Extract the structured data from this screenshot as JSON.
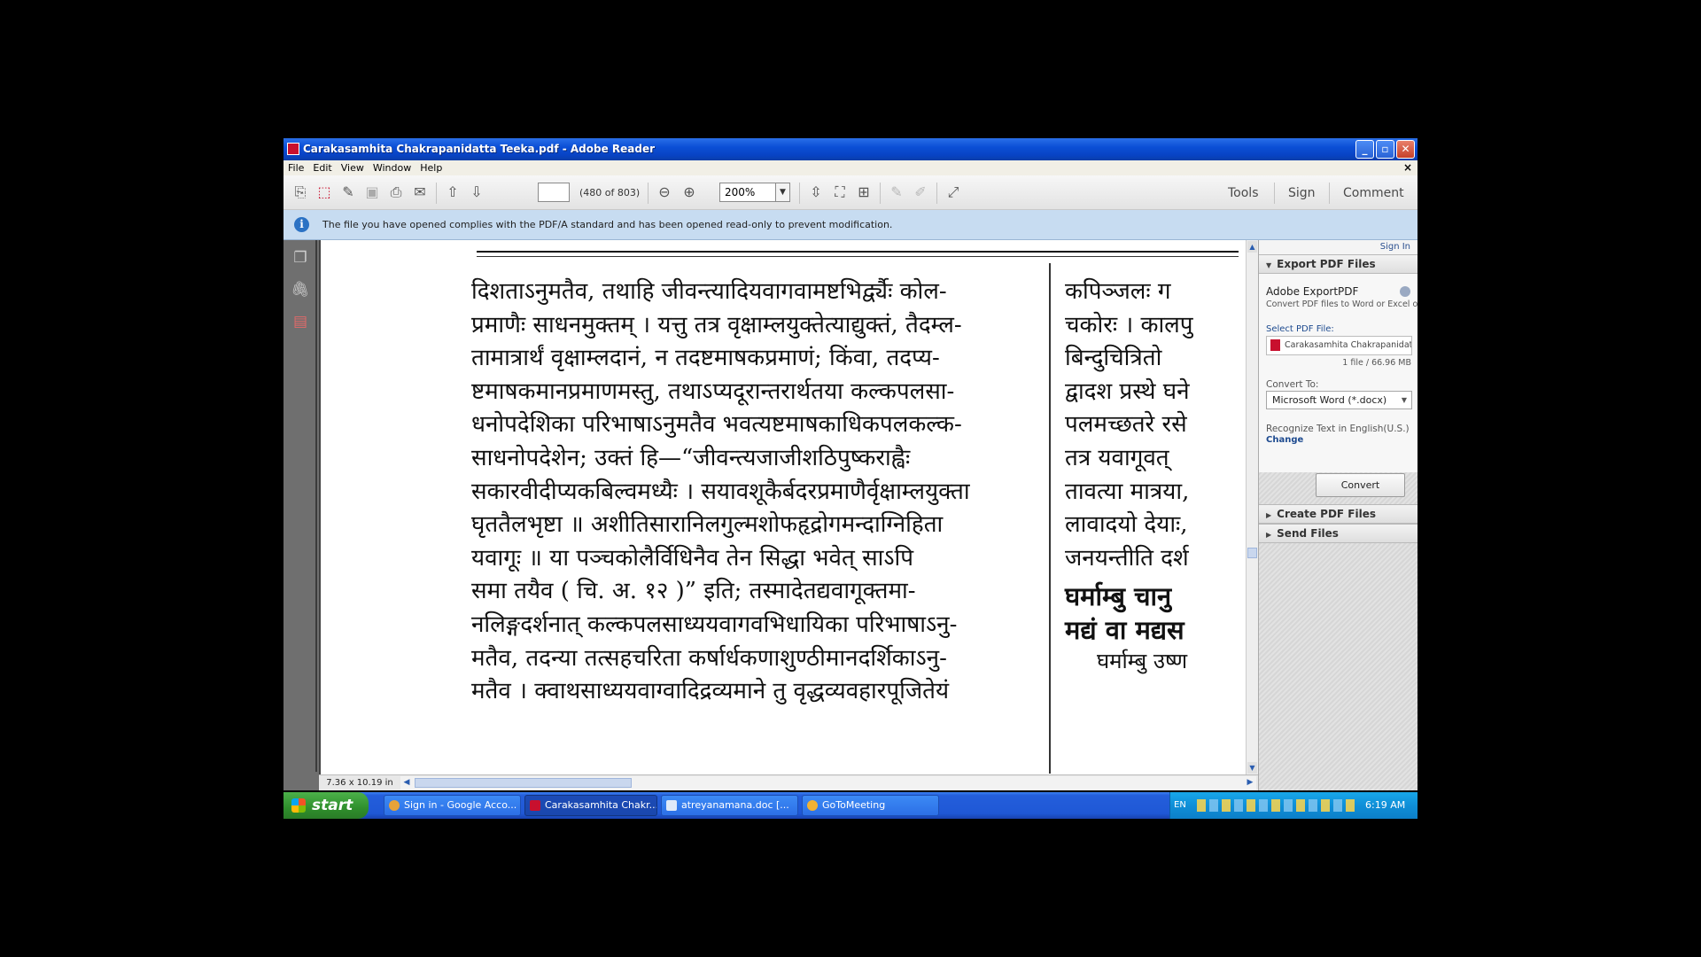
{
  "window": {
    "title": "Carakasamhita Chakrapanidatta Teeka.pdf - Adobe Reader",
    "min": "_",
    "max": "▫",
    "close": "✕"
  },
  "menu": {
    "items": [
      "File",
      "Edit",
      "View",
      "Window",
      "Help"
    ],
    "doc_close": "×"
  },
  "toolbar": {
    "page_input_value": "",
    "page_count": "(480 of 803)",
    "zoom": "200%",
    "tabs": [
      "Tools",
      "Sign",
      "Comment"
    ]
  },
  "infobar": {
    "text": "The file you have opened complies with the PDF/A standard and has been opened read-only to prevent modification."
  },
  "document": {
    "column1": [
      "दिशताऽनुमतैव, तथाहि जीवन्त्यादियवागवामष्टभिर्द्व्यैः कोल-",
      "प्रमाणैः साधनमुक्तम् । यत्तु तत्र वृक्षाम्लयुक्तेत्याद्युक्तं, तैदम्ल-",
      "तामात्रार्थं वृक्षाम्लदानं, न तदष्टमाषकप्रमाणं; किंवा, तदप्य-",
      "ष्टमाषकमानप्रमाणमस्तु, तथाऽप्यदूरान्तरार्थतया कल्कपलसा-",
      "धनोपदेशिका परिभाषाऽनुमतैव भवत्यष्टमाषकाधिकपलकल्क-",
      "साधनोपदेशेन; उक्तं हि—“जीवन्त्यजाजीशठिपुष्कराह्वैः",
      "सकारवीदीप्यकबिल्वमध्यैः । सयावशूकैर्बदरप्रमाणैर्वृक्षाम्लयुक्ता",
      "घृततैलभृष्टा ॥ अशीतिसारानिलगुल्मशोफहृद्रोगमन्दाग्निहिता",
      "यवागूः ॥ या पञ्चकोलैर्विधिनैव तेन सिद्धा भवेत् साऽपि",
      "समा तयैव ( चि. अ. १२ )” इति; तस्मादेतद्यवागूक्तमा-",
      "नलिङ्गदर्शनात् कल्कपलसाध्ययवागवभिधायिका परिभाषाऽनु-",
      "मतैव, तदन्या तत्सहचरिता कर्षार्धकणाशुण्ठीमानदर्शिकाऽनु-",
      "मतैव । क्वाथसाध्ययवाग्वादिद्रव्यमाने तु वृद्धव्यवहारपूजितेयं"
    ],
    "column2": [
      "कपिञ्जलः ग",
      "चकोरः । कालपु",
      "बिन्दुचित्रितो",
      "द्वादश प्रस्थे घने",
      "पलमच्छतरे रसे",
      "तत्र यवागूवत्",
      "तावत्या मात्रया,",
      "लावादयो देयाः,",
      "जनयन्तीति दर्श",
      "घर्माम्बु चानु",
      "मद्यं वा मद्यस",
      "घर्माम्बु उष्ण"
    ],
    "page_size": "7.36 x 10.19 in"
  },
  "right_panel": {
    "sign_in": "Sign In",
    "export_header": "Export PDF Files",
    "service_title": "Adobe ExportPDF",
    "service_desc": "Convert PDF files to Word or Excel online.",
    "select_label": "Select PDF File:",
    "selected_file": "Carakasamhita Chakrapanidatta T...",
    "file_info": "1 file / 66.96 MB",
    "convert_to_label": "Convert To:",
    "format": "Microsoft Word (*.docx)",
    "recognize": "Recognize Text in English(U.S.)",
    "change": "Change",
    "convert_button": "Convert",
    "create_header": "Create PDF Files",
    "send_header": "Send Files"
  },
  "taskbar": {
    "start": "start",
    "tasks": [
      "Sign in - Google Acco...",
      "Carakasamhita Chakr...",
      "atreyanamana.doc [...",
      "GoToMeeting"
    ],
    "lang": "EN",
    "clock": "6:19 AM"
  }
}
